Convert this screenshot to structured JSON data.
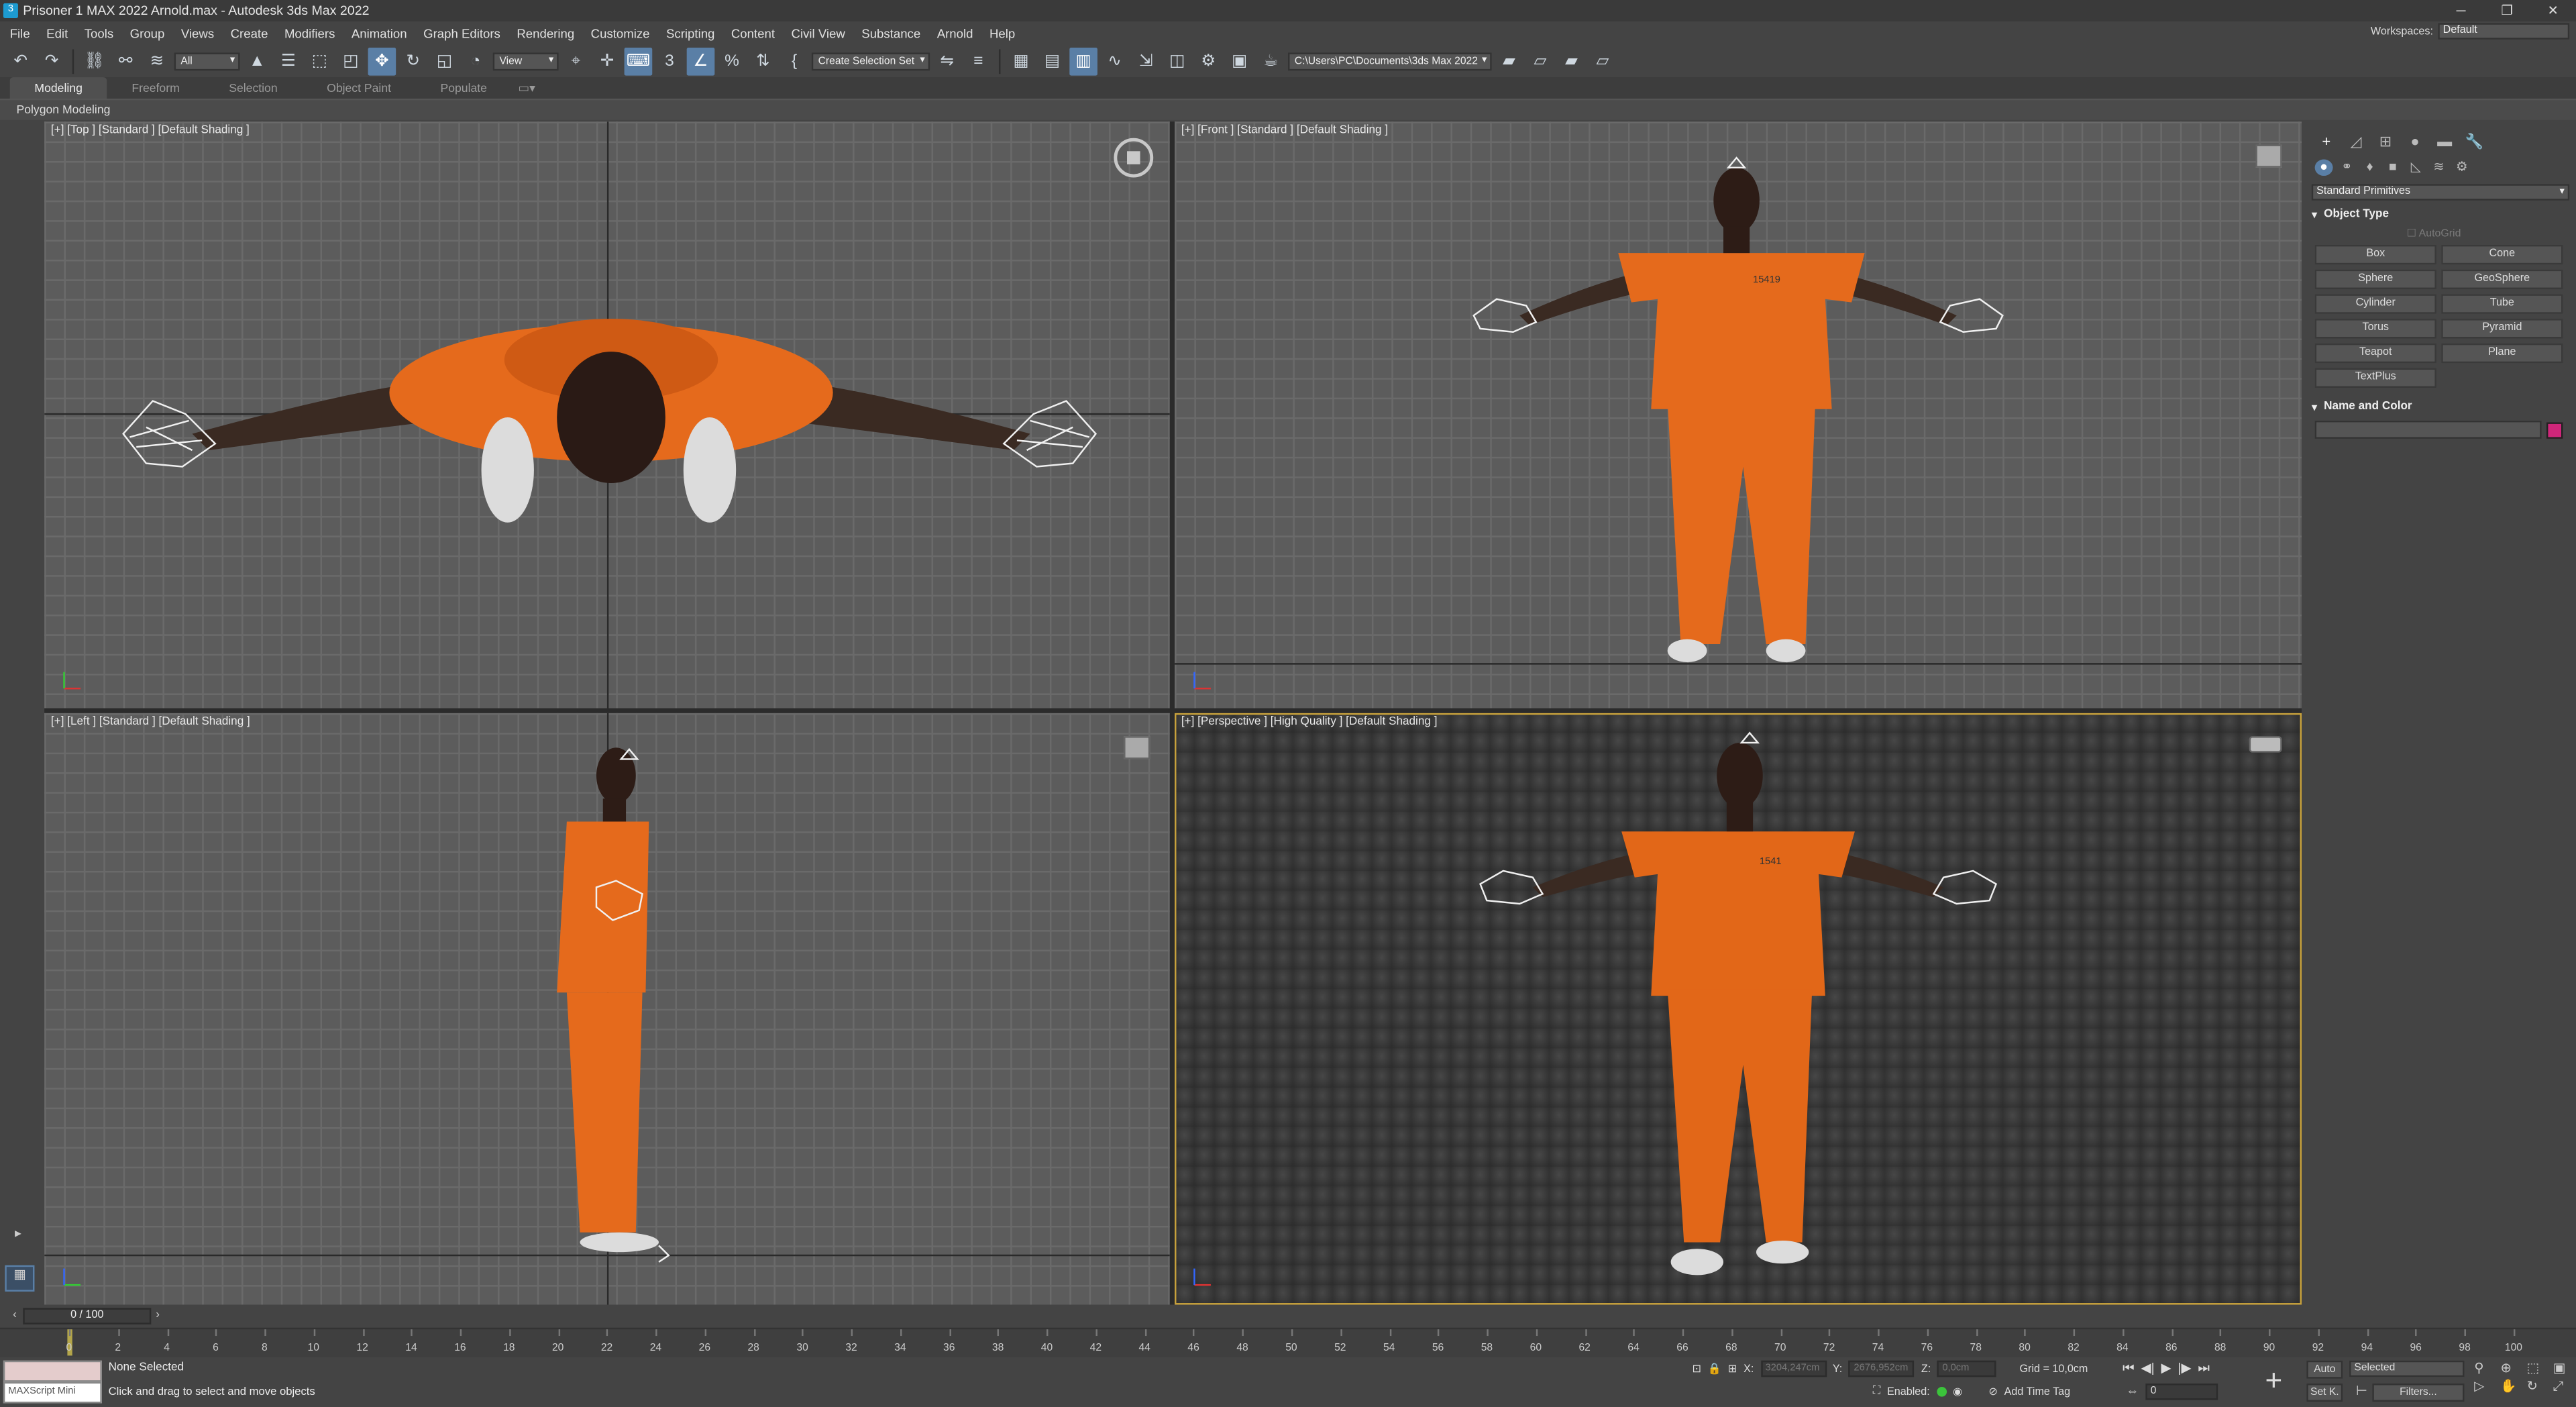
{
  "titlebar": {
    "title": "Prisoner 1 MAX 2022 Arnold.max - Autodesk 3ds Max 2022",
    "minimize": "─",
    "restore": "❐",
    "close": "✕"
  },
  "menu": [
    "File",
    "Edit",
    "Tools",
    "Group",
    "Views",
    "Create",
    "Modifiers",
    "Animation",
    "Graph Editors",
    "Rendering",
    "Customize",
    "Scripting",
    "Content",
    "Civil View",
    "Substance",
    "Arnold",
    "Help"
  ],
  "workspaces": {
    "label": "Workspaces:",
    "value": "Default"
  },
  "toolbar": {
    "selection_filter": "All",
    "ref_coord": "View",
    "named_selection": "Create Selection Set",
    "project_path": "C:\\Users\\PC\\Documents\\3ds Max 2022"
  },
  "ribbon": {
    "tabs": [
      "Modeling",
      "Freeform",
      "Selection",
      "Object Paint",
      "Populate"
    ],
    "active_tab": "Modeling",
    "panel_label": "Polygon Modeling"
  },
  "viewports": {
    "top": "[+] [Top ] [Standard ] [Default Shading ]",
    "front": "[+] [Front ] [Standard ] [Default Shading ]",
    "left": "[+] [Left ] [Standard ] [Default Shading ]",
    "perspective": "[+] [Perspective ] [High Quality ] [Default Shading ]",
    "shirt_number": "15419",
    "persp_shirt_number": "1541"
  },
  "command_panel": {
    "category": "Standard Primitives",
    "object_type_title": "Object Type",
    "autogrid": "AutoGrid",
    "primitives": [
      "Box",
      "Cone",
      "Sphere",
      "GeoSphere",
      "Cylinder",
      "Tube",
      "Torus",
      "Pyramid",
      "Teapot",
      "Plane",
      "TextPlus"
    ],
    "name_color_title": "Name and Color",
    "object_color": "#d0267a"
  },
  "timeline": {
    "frame_display": "0 / 100",
    "ticks": [
      "0",
      "2",
      "4",
      "6",
      "8",
      "10",
      "12",
      "14",
      "16",
      "18",
      "20",
      "22",
      "24",
      "26",
      "28",
      "30",
      "32",
      "34",
      "36",
      "38",
      "40",
      "42",
      "44",
      "46",
      "48",
      "50",
      "52",
      "54",
      "56",
      "58",
      "60",
      "62",
      "64",
      "66",
      "68",
      "70",
      "72",
      "74",
      "76",
      "78",
      "80",
      "82",
      "84",
      "86",
      "88",
      "90",
      "92",
      "94",
      "96",
      "98",
      "100"
    ]
  },
  "status": {
    "maxscript": "MAXScript Mini",
    "selection": "None Selected",
    "prompt": "Click and drag to select and move objects",
    "x_label": "X:",
    "x_value": "3204,247cm",
    "y_label": "Y:",
    "y_value": "2676,952cm",
    "z_label": "Z:",
    "z_value": "0,0cm",
    "grid": "Grid = 10,0cm",
    "enabled": "Enabled:",
    "add_time_tag": "Add Time Tag",
    "auto_key": "Auto",
    "set_key": "Set K.",
    "selected": "Selected",
    "filters": "Filters...",
    "current_frame": "0"
  }
}
